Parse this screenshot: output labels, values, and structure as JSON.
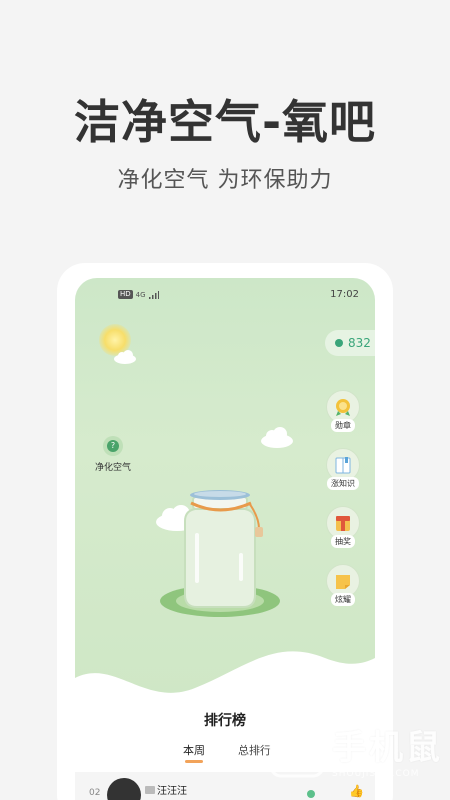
{
  "hero": {
    "title": "洁净空气-氧吧",
    "subtitle": "净化空气 为环保助力"
  },
  "status_bar": {
    "hd": "HD",
    "signal": "4G",
    "time": "17:02"
  },
  "score": {
    "value": "832"
  },
  "purify": {
    "label": "净化空气",
    "icon": "question-icon"
  },
  "side_buttons": [
    {
      "label": "勋章",
      "icon": "medal-icon"
    },
    {
      "label": "涨知识",
      "icon": "book-icon"
    },
    {
      "label": "抽奖",
      "icon": "gift-icon"
    },
    {
      "label": "炫耀",
      "icon": "share-note-icon"
    }
  ],
  "ranking": {
    "title": "排行榜",
    "tabs": [
      {
        "label": "本周"
      },
      {
        "label": "总排行"
      }
    ],
    "rows": [
      {
        "rank": "02",
        "name": "汪汪汪"
      }
    ]
  },
  "watermark": {
    "cn": "手机鼠",
    "en": "SHOUJISHU.COM"
  },
  "colors": {
    "accent": "#3aa57a",
    "tab_underline": "#f2a35a",
    "scene_green": "#cde7c8"
  }
}
